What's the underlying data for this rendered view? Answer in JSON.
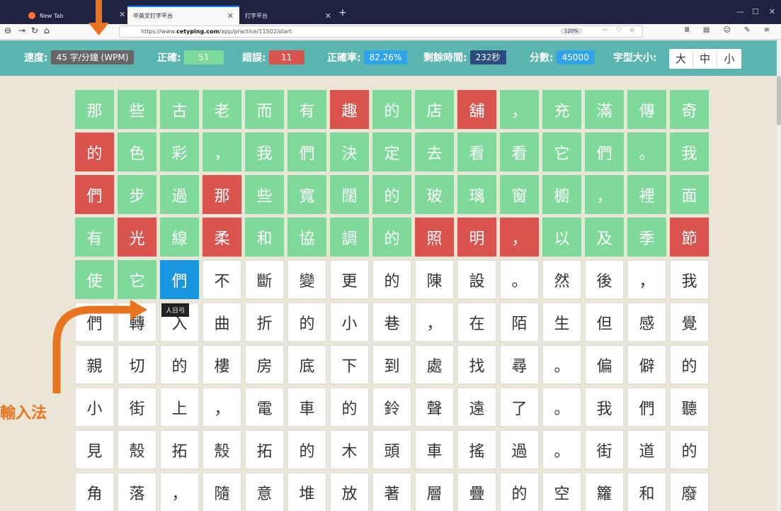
{
  "browser": {
    "tabs": [
      {
        "title": "New Tab"
      },
      {
        "title": "中英文打字平台"
      },
      {
        "title": "打字平台"
      }
    ],
    "url_prefix": "https://www.",
    "url_host": "cetyping.com",
    "url_path": "/app/practice/11502/start",
    "zoom": "120%"
  },
  "stats": {
    "speed_label": "速度:",
    "speed_value": "45 字/分鐘 (WPM)",
    "correct_label": "正確:",
    "correct_value": "51",
    "errors_label": "錯誤:",
    "errors_value": "11",
    "accuracy_label": "正確率:",
    "accuracy_value": "82.26%",
    "time_label": "剩餘時間:",
    "time_value": "232秒",
    "score_label": "分數:",
    "score_value": "45000",
    "fontsize_label": "字型大小:",
    "fontsize_options": [
      "大",
      "中",
      "小"
    ]
  },
  "ime": {
    "annotation_label": "輸入法",
    "tooltip": "人日弓"
  },
  "grid_rows": [
    [
      [
        "那",
        "c"
      ],
      [
        "些",
        "c"
      ],
      [
        "古",
        "c"
      ],
      [
        "老",
        "c"
      ],
      [
        "而",
        "c"
      ],
      [
        "有",
        "c"
      ],
      [
        "趣",
        "w"
      ],
      [
        "的",
        "c"
      ],
      [
        "店",
        "c"
      ],
      [
        "舖",
        "w"
      ],
      [
        "，",
        "c"
      ],
      [
        "充",
        "c"
      ],
      [
        "滿",
        "c"
      ],
      [
        "傳",
        "c"
      ],
      [
        "奇",
        "c"
      ]
    ],
    [
      [
        "的",
        "w"
      ],
      [
        "色",
        "c"
      ],
      [
        "彩",
        "c"
      ],
      [
        "，",
        "c"
      ],
      [
        "我",
        "c"
      ],
      [
        "們",
        "c"
      ],
      [
        "決",
        "c"
      ],
      [
        "定",
        "c"
      ],
      [
        "去",
        "c"
      ],
      [
        "看",
        "c"
      ],
      [
        "看",
        "c"
      ],
      [
        "它",
        "c"
      ],
      [
        "們",
        "c"
      ],
      [
        "。",
        "c"
      ],
      [
        "我",
        "c"
      ]
    ],
    [
      [
        "們",
        "w"
      ],
      [
        "步",
        "c"
      ],
      [
        "過",
        "c"
      ],
      [
        "那",
        "w"
      ],
      [
        "些",
        "c"
      ],
      [
        "寬",
        "c"
      ],
      [
        "闊",
        "c"
      ],
      [
        "的",
        "c"
      ],
      [
        "玻",
        "c"
      ],
      [
        "璃",
        "c"
      ],
      [
        "窗",
        "c"
      ],
      [
        "櫥",
        "c"
      ],
      [
        "，",
        "c"
      ],
      [
        "裡",
        "c"
      ],
      [
        "面",
        "c"
      ]
    ],
    [
      [
        "有",
        "c"
      ],
      [
        "光",
        "w"
      ],
      [
        "線",
        "c"
      ],
      [
        "柔",
        "w"
      ],
      [
        "和",
        "c"
      ],
      [
        "協",
        "c"
      ],
      [
        "調",
        "c"
      ],
      [
        "的",
        "c"
      ],
      [
        "照",
        "w"
      ],
      [
        "明",
        "w"
      ],
      [
        "，",
        "w"
      ],
      [
        "以",
        "c"
      ],
      [
        "及",
        "c"
      ],
      [
        "季",
        "c"
      ],
      [
        "節",
        "w"
      ]
    ],
    [
      [
        "使",
        "c"
      ],
      [
        "它",
        "c"
      ],
      [
        "們",
        "a"
      ],
      [
        "不",
        ""
      ],
      [
        "斷",
        ""
      ],
      [
        "變",
        ""
      ],
      [
        "更",
        ""
      ],
      [
        "的",
        ""
      ],
      [
        "陳",
        ""
      ],
      [
        "設",
        ""
      ],
      [
        "。",
        ""
      ],
      [
        "然",
        ""
      ],
      [
        "後",
        ""
      ],
      [
        "，",
        ""
      ],
      [
        "我",
        ""
      ]
    ],
    [
      [
        "們",
        ""
      ],
      [
        "轉",
        ""
      ],
      [
        "入",
        ""
      ],
      [
        "曲",
        ""
      ],
      [
        "折",
        ""
      ],
      [
        "的",
        ""
      ],
      [
        "小",
        ""
      ],
      [
        "巷",
        ""
      ],
      [
        "，",
        ""
      ],
      [
        "在",
        ""
      ],
      [
        "陌",
        ""
      ],
      [
        "生",
        ""
      ],
      [
        "但",
        ""
      ],
      [
        "感",
        ""
      ],
      [
        "覺",
        ""
      ]
    ],
    [
      [
        "親",
        ""
      ],
      [
        "切",
        ""
      ],
      [
        "的",
        ""
      ],
      [
        "樓",
        ""
      ],
      [
        "房",
        ""
      ],
      [
        "底",
        ""
      ],
      [
        "下",
        ""
      ],
      [
        "到",
        ""
      ],
      [
        "處",
        ""
      ],
      [
        "找",
        ""
      ],
      [
        "尋",
        ""
      ],
      [
        "。",
        ""
      ],
      [
        "偏",
        ""
      ],
      [
        "僻",
        ""
      ],
      [
        "的",
        ""
      ]
    ],
    [
      [
        "小",
        ""
      ],
      [
        "街",
        ""
      ],
      [
        "上",
        ""
      ],
      [
        "，",
        ""
      ],
      [
        "電",
        ""
      ],
      [
        "車",
        ""
      ],
      [
        "的",
        ""
      ],
      [
        "鈴",
        ""
      ],
      [
        "聲",
        ""
      ],
      [
        "遠",
        ""
      ],
      [
        "了",
        ""
      ],
      [
        "。",
        ""
      ],
      [
        "我",
        ""
      ],
      [
        "們",
        ""
      ],
      [
        "聽",
        ""
      ]
    ],
    [
      [
        "見",
        ""
      ],
      [
        "殼",
        ""
      ],
      [
        "拓",
        ""
      ],
      [
        "殼",
        ""
      ],
      [
        "拓",
        ""
      ],
      [
        "的",
        ""
      ],
      [
        "木",
        ""
      ],
      [
        "頭",
        ""
      ],
      [
        "車",
        ""
      ],
      [
        "搖",
        ""
      ],
      [
        "過",
        ""
      ],
      [
        "。",
        ""
      ],
      [
        "街",
        ""
      ],
      [
        "道",
        ""
      ],
      [
        "的",
        ""
      ]
    ],
    [
      [
        "角",
        ""
      ],
      [
        "落",
        ""
      ],
      [
        "，",
        ""
      ],
      [
        "隨",
        ""
      ],
      [
        "意",
        ""
      ],
      [
        "堆",
        ""
      ],
      [
        "放",
        ""
      ],
      [
        "著",
        ""
      ],
      [
        "層",
        ""
      ],
      [
        "疊",
        ""
      ],
      [
        "的",
        ""
      ],
      [
        "空",
        ""
      ],
      [
        "籮",
        ""
      ],
      [
        "和",
        ""
      ],
      [
        "廢",
        ""
      ]
    ]
  ],
  "colors": {
    "correct": "#7fd99a",
    "wrong": "#d9534f",
    "active": "#1897e0",
    "annotation": "#e9741f",
    "statsbar": "#5bb5ae"
  }
}
